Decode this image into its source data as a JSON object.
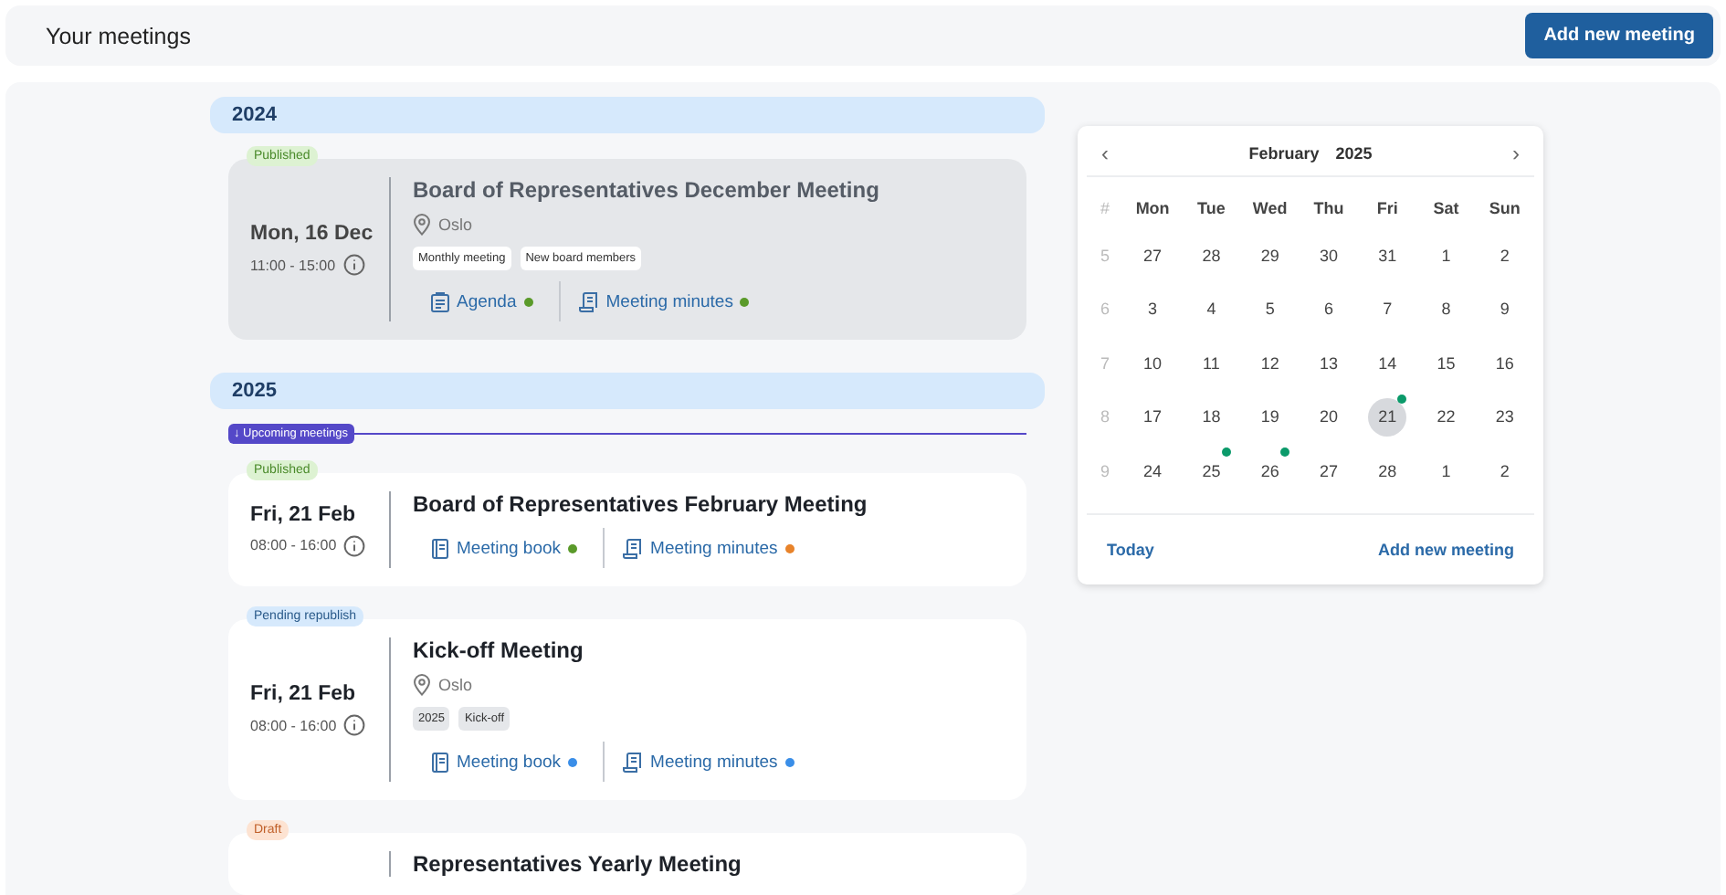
{
  "header": {
    "title": "Your meetings",
    "button": "Add new meeting"
  },
  "years": [
    {
      "year": "2024",
      "meetings": [
        {
          "status": {
            "label": "Published",
            "kind": "published"
          },
          "past": true,
          "date": "Mon, 16 Dec",
          "time": "11:00 - 15:00",
          "title": "Board of Representatives December Meeting",
          "location": "Oslo",
          "tags": [
            "Monthly meeting",
            "New board members"
          ],
          "documents": [
            {
              "label": "Agenda",
              "kind": "agenda",
              "color": "#5a9a2a"
            },
            {
              "label": "Meeting minutes",
              "kind": "minutes",
              "color": "#5a9a2a"
            }
          ]
        }
      ]
    },
    {
      "year": "2025",
      "marker": "↓ Upcoming meetings",
      "meetings": [
        {
          "status": {
            "label": "Published",
            "kind": "published"
          },
          "past": false,
          "date": "Fri, 21 Feb",
          "time": "08:00 - 16:00",
          "title": "Board of Representatives February Meeting",
          "documents": [
            {
              "label": "Meeting book",
              "kind": "book",
              "color": "#5a9a2a"
            },
            {
              "label": "Meeting minutes",
              "kind": "minutes",
              "color": "#e8832a"
            }
          ]
        },
        {
          "status": {
            "label": "Pending republish",
            "kind": "pending"
          },
          "past": false,
          "date": "Fri, 21 Feb",
          "time": "08:00 - 16:00",
          "title": "Kick-off Meeting",
          "location": "Oslo",
          "tags": [
            "2025",
            "Kick-off"
          ],
          "documents": [
            {
              "label": "Meeting book",
              "kind": "book",
              "color": "#3a8ee8"
            },
            {
              "label": "Meeting minutes",
              "kind": "minutes",
              "color": "#3a8ee8"
            }
          ]
        },
        {
          "status": {
            "label": "Draft",
            "kind": "draft"
          },
          "past": false,
          "title": "Representatives Yearly Meeting"
        }
      ]
    }
  ],
  "calendar": {
    "prev": "‹",
    "next": "›",
    "month": "February",
    "year": "2025",
    "week_header": "#",
    "weekdays": [
      "Mon",
      "Tue",
      "Wed",
      "Thu",
      "Fri",
      "Sat",
      "Sun"
    ],
    "weeks": [
      {
        "number": "5",
        "days": [
          {
            "label": "27",
            "selected": false,
            "event": false
          },
          {
            "label": "28",
            "selected": false,
            "event": false
          },
          {
            "label": "29",
            "selected": false,
            "event": false
          },
          {
            "label": "30",
            "selected": false,
            "event": false
          },
          {
            "label": "31",
            "selected": false,
            "event": false
          },
          {
            "label": "1",
            "selected": false,
            "event": false
          },
          {
            "label": "2",
            "selected": false,
            "event": false
          }
        ]
      },
      {
        "number": "6",
        "days": [
          {
            "label": "3",
            "selected": false,
            "event": false
          },
          {
            "label": "4",
            "selected": false,
            "event": false
          },
          {
            "label": "5",
            "selected": false,
            "event": false
          },
          {
            "label": "6",
            "selected": false,
            "event": false
          },
          {
            "label": "7",
            "selected": false,
            "event": false
          },
          {
            "label": "8",
            "selected": false,
            "event": false
          },
          {
            "label": "9",
            "selected": false,
            "event": false
          }
        ]
      },
      {
        "number": "7",
        "days": [
          {
            "label": "10",
            "selected": false,
            "event": false
          },
          {
            "label": "11",
            "selected": false,
            "event": false
          },
          {
            "label": "12",
            "selected": false,
            "event": false
          },
          {
            "label": "13",
            "selected": false,
            "event": false
          },
          {
            "label": "14",
            "selected": false,
            "event": false
          },
          {
            "label": "15",
            "selected": false,
            "event": false
          },
          {
            "label": "16",
            "selected": false,
            "event": false
          }
        ]
      },
      {
        "number": "8",
        "days": [
          {
            "label": "17",
            "selected": false,
            "event": false
          },
          {
            "label": "18",
            "selected": false,
            "event": false
          },
          {
            "label": "19",
            "selected": false,
            "event": false
          },
          {
            "label": "20",
            "selected": false,
            "event": false
          },
          {
            "label": "21",
            "selected": true,
            "event": true
          },
          {
            "label": "22",
            "selected": false,
            "event": false
          },
          {
            "label": "23",
            "selected": false,
            "event": false
          }
        ]
      },
      {
        "number": "9",
        "days": [
          {
            "label": "24",
            "selected": false,
            "event": false
          },
          {
            "label": "25",
            "selected": false,
            "event": true
          },
          {
            "label": "26",
            "selected": false,
            "event": true
          },
          {
            "label": "27",
            "selected": false,
            "event": false
          },
          {
            "label": "28",
            "selected": false,
            "event": false
          },
          {
            "label": "1",
            "selected": false,
            "event": false
          },
          {
            "label": "2",
            "selected": false,
            "event": false
          }
        ]
      }
    ],
    "today": "Today",
    "add": "Add new meeting"
  }
}
